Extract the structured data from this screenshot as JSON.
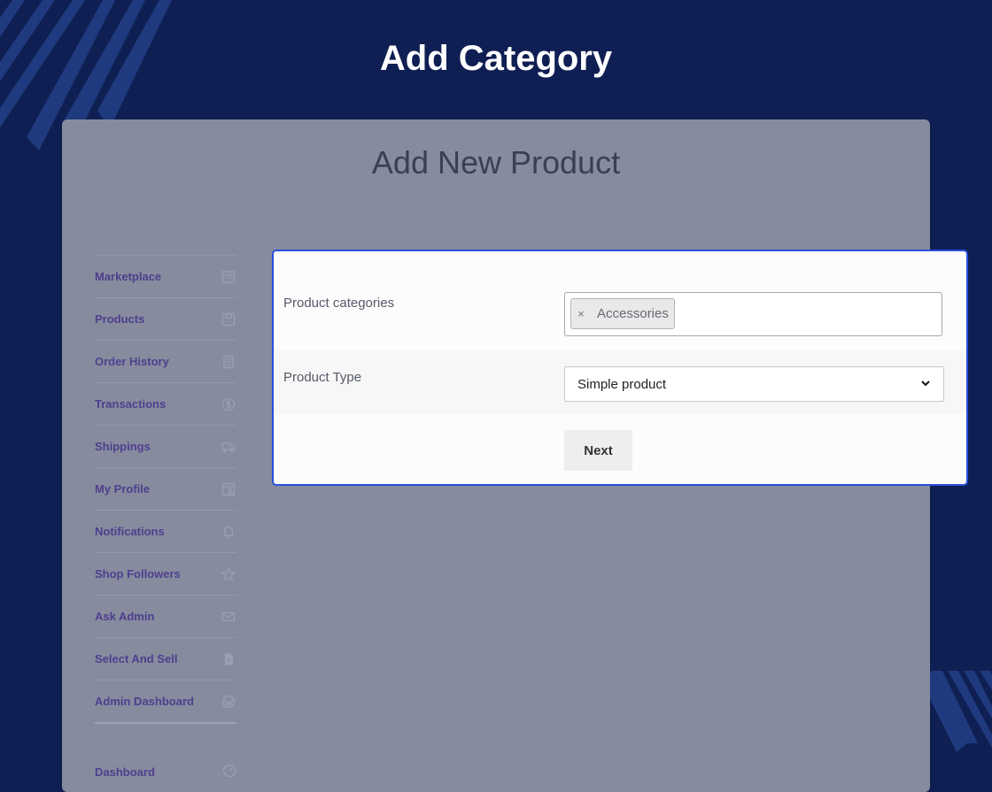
{
  "page_title": "Add Category",
  "card_title": "Add New Product",
  "menu": {
    "items": [
      {
        "label": "Marketplace",
        "icon": "store-icon"
      },
      {
        "label": "Products",
        "icon": "box-icon"
      },
      {
        "label": "Order History",
        "icon": "document-icon"
      },
      {
        "label": "Transactions",
        "icon": "dollar-icon"
      },
      {
        "label": "Shippings",
        "icon": "truck-icon"
      },
      {
        "label": "My Profile",
        "icon": "profile-icon"
      },
      {
        "label": "Notifications",
        "icon": "bell-icon"
      },
      {
        "label": "Shop Followers",
        "icon": "star-icon"
      },
      {
        "label": "Ask Admin",
        "icon": "envelope-icon"
      },
      {
        "label": "Select And Sell",
        "icon": "file-icon"
      },
      {
        "label": "Admin Dashboard",
        "icon": "wordpress-icon"
      }
    ],
    "dashboard_label": "Dashboard"
  },
  "form": {
    "categories_label": "Product categories",
    "category_tag": "Accessories",
    "tag_remove": "×",
    "type_label": "Product Type",
    "type_value": "Simple product",
    "next_label": "Next"
  },
  "colors": {
    "background": "#101f53",
    "card": "#868b9e",
    "menu_text": "#4e3f8e",
    "dialog_border": "#2c4fd9"
  }
}
